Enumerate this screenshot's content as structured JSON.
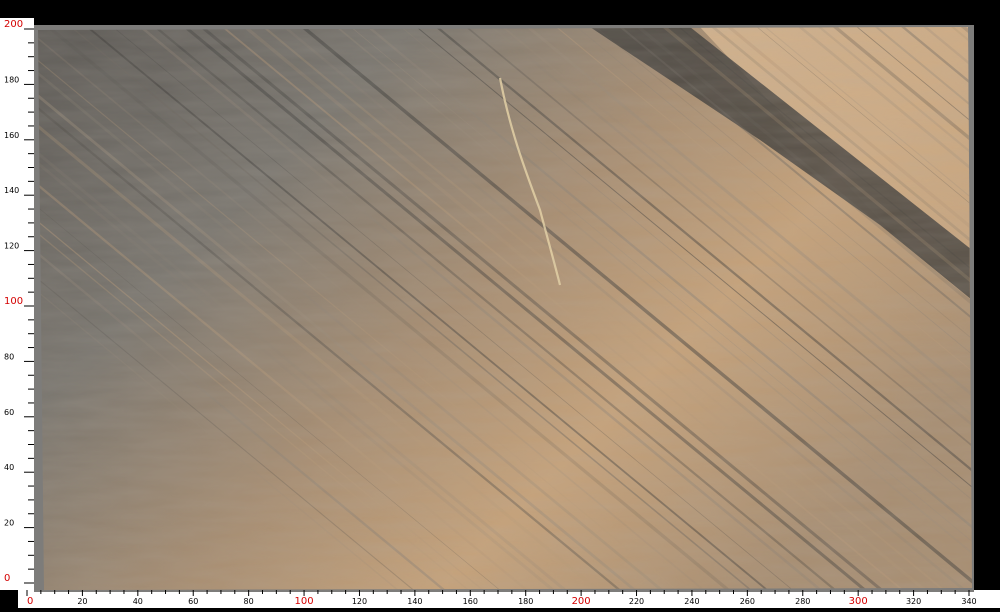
{
  "image": {
    "subject": "polished stone slab",
    "ruler_unit_hint": "cm"
  },
  "rulers": {
    "x": {
      "min": 0,
      "max": 340,
      "step_label": 20,
      "step_minor": 5,
      "labels": [
        "0",
        "20",
        "40",
        "60",
        "80",
        "100",
        "120",
        "140",
        "160",
        "180",
        "200",
        "220",
        "240",
        "260",
        "280",
        "300",
        "320",
        "340"
      ],
      "highlight_labels": [
        "0",
        "100",
        "200",
        "300"
      ]
    },
    "y": {
      "min": 0,
      "max": 200,
      "step_label": 20,
      "step_minor": 5,
      "labels": [
        "0",
        "20",
        "40",
        "60",
        "80",
        "100",
        "120",
        "140",
        "160",
        "180",
        "200"
      ],
      "highlight_labels": [
        "0",
        "100",
        "200"
      ]
    }
  },
  "colors": {
    "background": "#000000",
    "ruler_background": "#ffffff",
    "tick": "#000000",
    "label": "#000000",
    "label_highlight": "#d40000",
    "slab_grey_dark": "#5a5753",
    "slab_grey": "#7a766f",
    "slab_tan": "#a88e72",
    "slab_ochre": "#c6a27a",
    "slab_vein_dark": "#3b3a38",
    "frame": "#7d7c7a"
  }
}
